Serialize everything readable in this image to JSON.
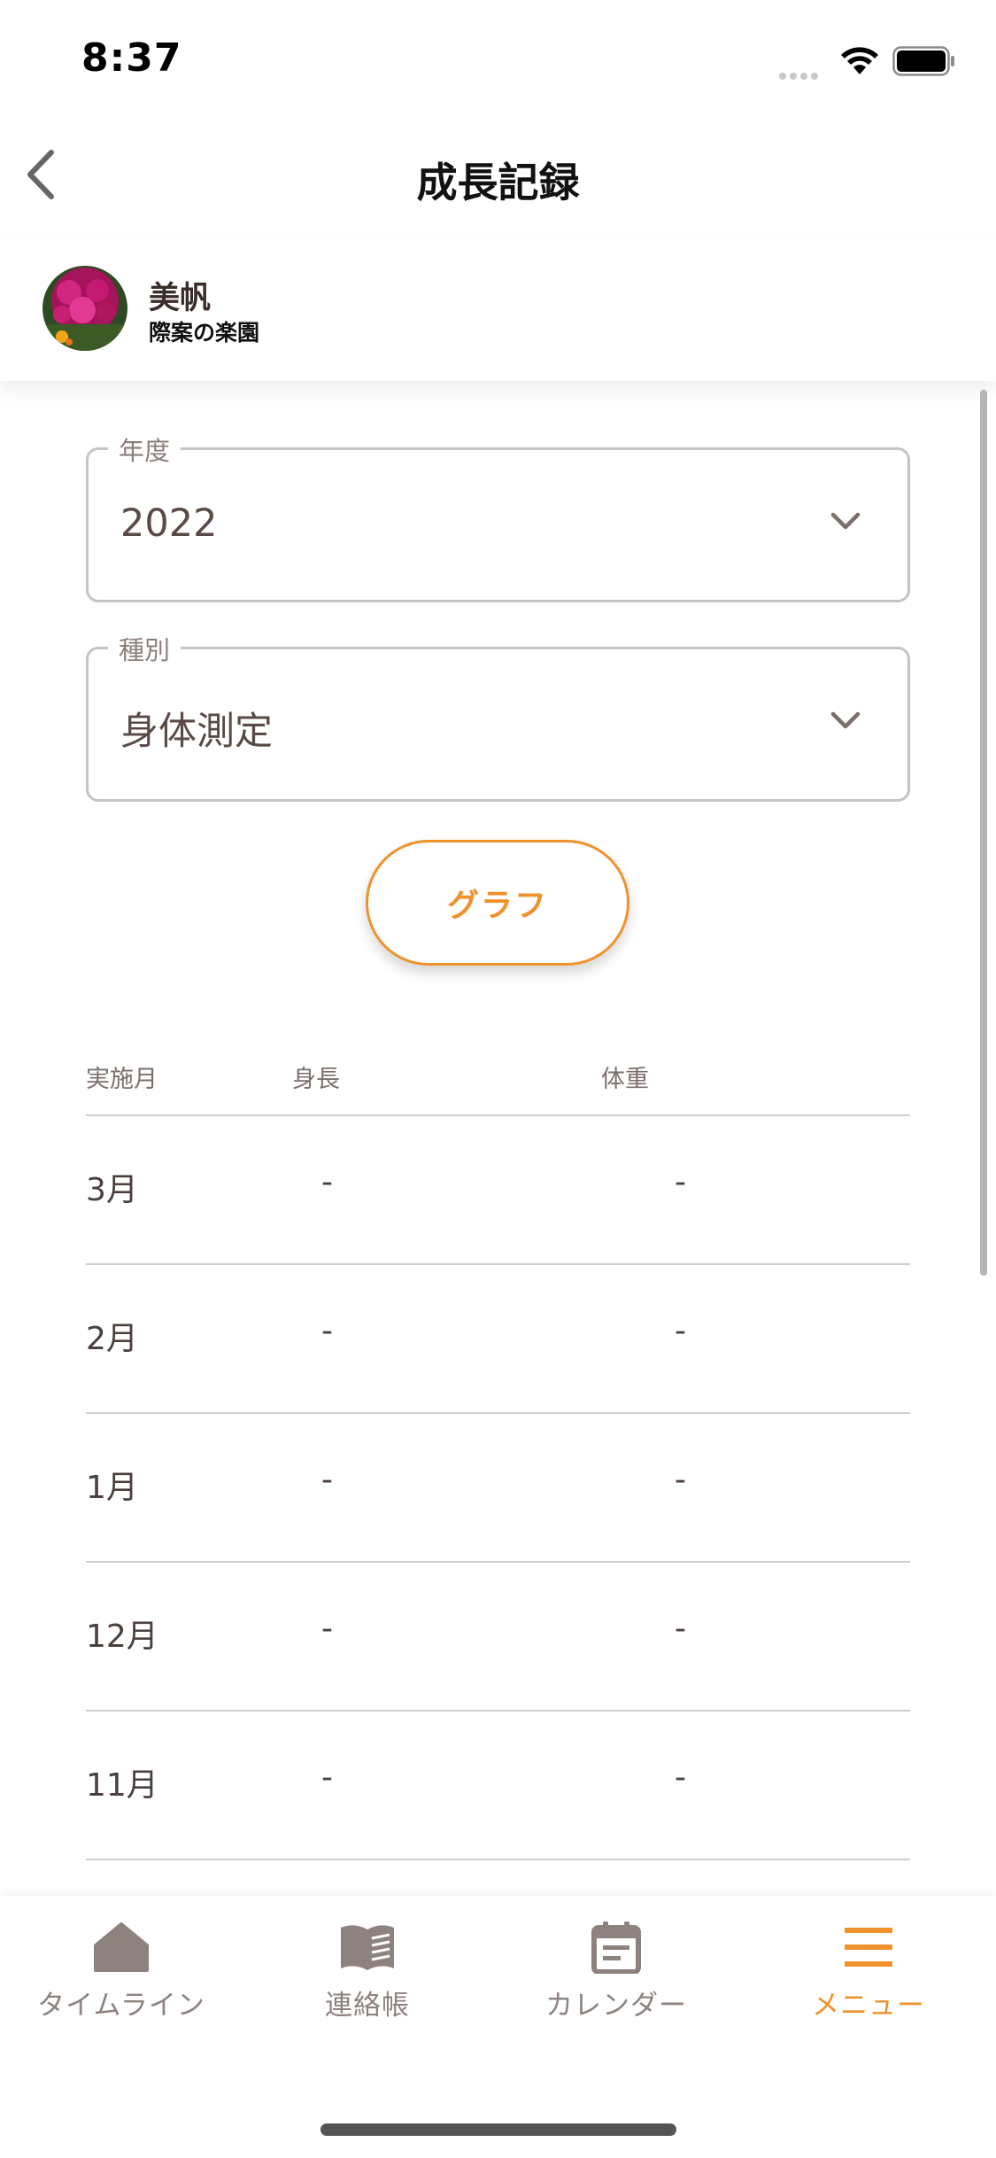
{
  "status": {
    "time": "8:37"
  },
  "nav": {
    "title": "成長記録"
  },
  "child": {
    "name": "美帆",
    "school": "際案の楽園"
  },
  "filters": {
    "year": {
      "label": "年度",
      "value": "2022"
    },
    "type": {
      "label": "種別",
      "value": "身体測定"
    }
  },
  "graph_button": {
    "label": "グラフ"
  },
  "table": {
    "columns": [
      "実施月",
      "身長",
      "体重"
    ],
    "rows": [
      {
        "month": "3月",
        "height": "-",
        "weight": "-"
      },
      {
        "month": "2月",
        "height": "-",
        "weight": "-"
      },
      {
        "month": "1月",
        "height": "-",
        "weight": "-"
      },
      {
        "month": "12月",
        "height": "-",
        "weight": "-"
      },
      {
        "month": "11月",
        "height": "-",
        "weight": "-"
      }
    ]
  },
  "tabs": [
    {
      "label": "タイムライン",
      "icon": "home-icon",
      "active": false
    },
    {
      "label": "連絡帳",
      "icon": "book-icon",
      "active": false
    },
    {
      "label": "カレンダー",
      "icon": "calendar-icon",
      "active": false
    },
    {
      "label": "メニュー",
      "icon": "menu-icon",
      "active": true
    }
  ],
  "colors": {
    "accent": "#f0922b",
    "icon": "#8d827e",
    "text_dark": "#3a2d2a"
  }
}
